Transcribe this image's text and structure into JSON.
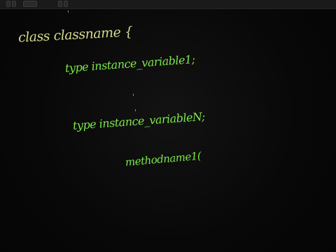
{
  "toolbar": {
    "buttons": [
      "",
      "",
      "",
      "",
      ""
    ]
  },
  "board": {
    "lines": [
      "class classname {",
      "type instance_variable1;",
      "type instance_variableN;",
      "methodname1("
    ]
  },
  "colors": {
    "background": "#070707",
    "chalk_yellow": "#d4d98a",
    "chalk_green": "#7be84a"
  }
}
